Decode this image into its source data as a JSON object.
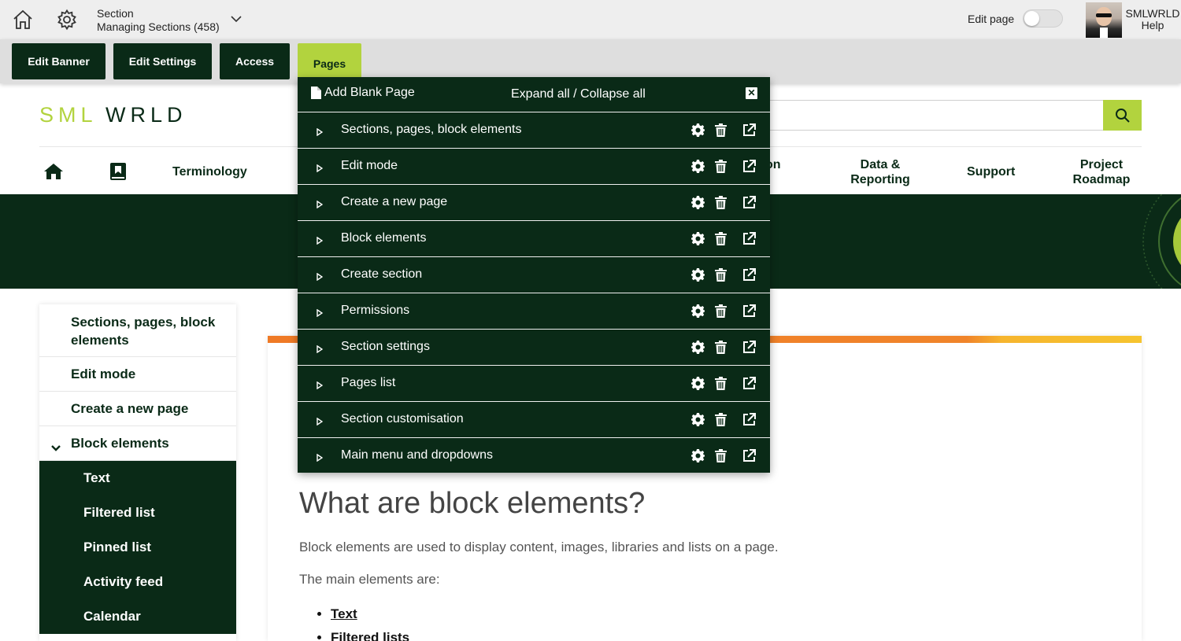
{
  "admin_bar": {
    "section_label": "Section",
    "section_name": "Managing Sections (458)",
    "edit_page_label": "Edit page",
    "user_name": "SMLWRLD",
    "help_label": "Help"
  },
  "tabs": {
    "edit_banner": "Edit Banner",
    "edit_settings": "Edit Settings",
    "access": "Access",
    "pages": "Pages"
  },
  "site": {
    "logo_text": "SMLWRLD",
    "nav": {
      "terminology": "Terminology",
      "partial": "on",
      "data_reporting_1": "Data &",
      "data_reporting_2": "Reporting",
      "support": "Support",
      "project_1": "Project",
      "project_2": "Roadmap"
    }
  },
  "pages_panel": {
    "add_blank_page": "Add Blank Page",
    "expand_collapse": "Expand all / Collapse all",
    "rows": [
      "Sections, pages, block elements",
      "Edit mode",
      "Create a new page",
      "Block elements",
      "Create section",
      "Permissions",
      "Section settings",
      "Pages list",
      "Section customisation",
      "Main menu and dropdowns"
    ]
  },
  "sidenav": {
    "items": [
      "Sections, pages, block elements",
      "Edit mode",
      "Create a new page",
      "Block elements"
    ],
    "subitems": [
      "Text",
      "Filtered list",
      "Pinned list",
      "Activity feed",
      "Calendar"
    ]
  },
  "main": {
    "heading": "What are block elements?",
    "paragraph1": "Block elements are used to display content, images, libraries and lists on a page.",
    "paragraph2": "The main elements are:",
    "list": [
      "Text",
      "Filtered lists"
    ]
  },
  "colors": {
    "dark_green": "#0a2a17",
    "lime": "#b2d33e",
    "orange": "#ef7a26"
  }
}
